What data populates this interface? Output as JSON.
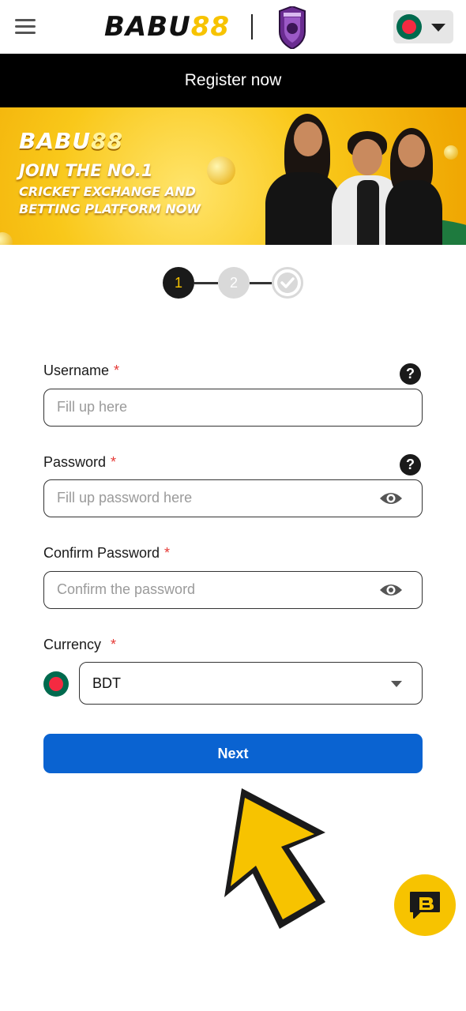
{
  "header": {
    "logo_part1": "BABU",
    "logo_part2": "88",
    "language_flag": "bangladesh-flag"
  },
  "register_bar": {
    "title": "Register now"
  },
  "banner": {
    "logo_part1": "BABU",
    "logo_part2": "88",
    "line1": "JOIN THE NO.1",
    "line2": "CRICKET EXCHANGE AND",
    "line3": "BETTING PLATFORM NOW"
  },
  "stepper": {
    "steps": [
      {
        "label": "1",
        "state": "active"
      },
      {
        "label": "2",
        "state": "inactive"
      },
      {
        "label": "",
        "icon": "check-icon",
        "state": "inactive"
      }
    ]
  },
  "form": {
    "username": {
      "label": "Username",
      "required": "*",
      "placeholder": "Fill up here",
      "value": ""
    },
    "password": {
      "label": "Password",
      "required": "*",
      "placeholder": "Fill up password here",
      "value": ""
    },
    "confirm_password": {
      "label": "Confirm Password",
      "required": "*",
      "placeholder": "Confirm the password",
      "value": ""
    },
    "currency": {
      "label": "Currency",
      "required": "*",
      "selected": "BDT",
      "flag": "bangladesh-flag"
    },
    "help_glyph": "?",
    "next_label": "Next"
  },
  "colors": {
    "accent_blue": "#0a63d1",
    "brand_yellow": "#f7c300",
    "header_black": "#000000",
    "required_red": "#e53935"
  },
  "icons": [
    "hamburger-icon",
    "help-icon",
    "eye-icon",
    "chevron-down-icon",
    "chat-icon",
    "pointer-arrow-icon"
  ]
}
